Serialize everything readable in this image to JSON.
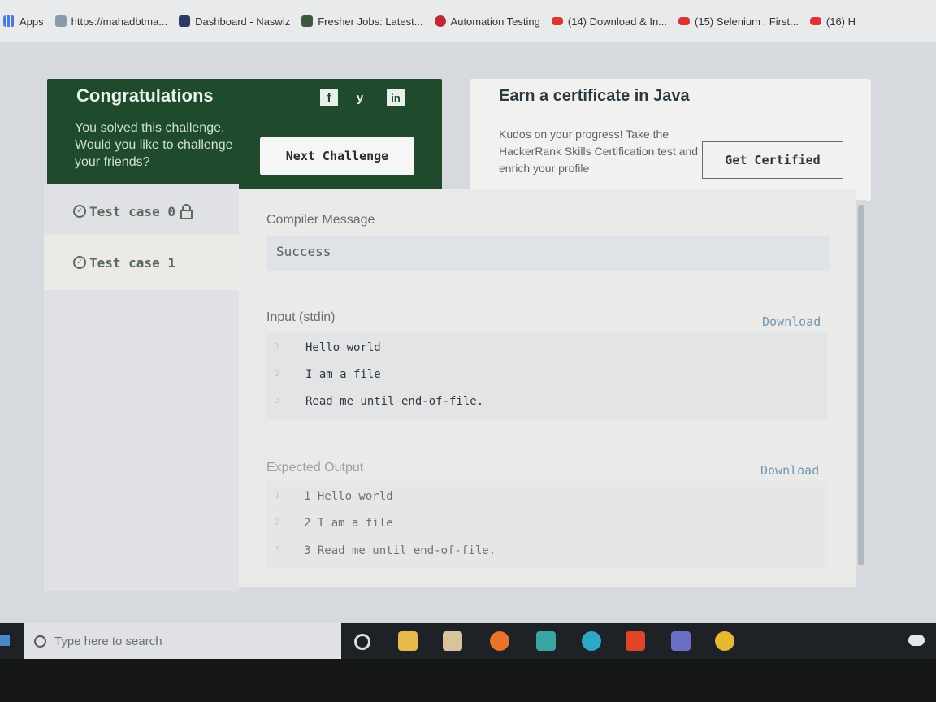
{
  "bookmarks": [
    {
      "label": "Apps",
      "icon": "apps-grid-icon",
      "color": "#4a7bd6"
    },
    {
      "label": "https://mahadbtma...",
      "icon": "page-icon",
      "color": "#8a9aa8"
    },
    {
      "label": "Dashboard - Naswiz",
      "icon": "naswiz-icon",
      "color": "#2b3a67"
    },
    {
      "label": "Fresher Jobs: Latest...",
      "icon": "fresher-jobs-icon",
      "color": "#3a5a3a"
    },
    {
      "label": "Automation Testing",
      "icon": "automation-icon",
      "color": "#c0283a"
    },
    {
      "label": "(14) Download & In...",
      "icon": "youtube-icon",
      "color": "#d33333"
    },
    {
      "label": "(15) Selenium : First...",
      "icon": "youtube-icon",
      "color": "#d33333"
    },
    {
      "label": "(16) H",
      "icon": "youtube-icon",
      "color": "#d33333"
    }
  ],
  "congrats": {
    "title": "Congratulations",
    "text": "You solved this challenge. Would you like to challenge your friends?",
    "next_button": "Next Challenge",
    "social": [
      "f",
      "y",
      "in"
    ]
  },
  "certificate": {
    "title": "Earn a certificate in Java",
    "text": "Kudos on your progress! Take the HackerRank Skills Certification test and enrich your profile",
    "button": "Get Certified"
  },
  "test_cases": [
    {
      "label": "Test case 0",
      "locked": true,
      "active": false
    },
    {
      "label": "Test case 1",
      "locked": false,
      "active": true
    }
  ],
  "compiler": {
    "label": "Compiler Message",
    "message": "Success"
  },
  "input": {
    "label": "Input (stdin)",
    "download": "Download",
    "lines": [
      {
        "num": "1",
        "text": "Hello world"
      },
      {
        "num": "2",
        "text": "I am a file"
      },
      {
        "num": "3",
        "text": "Read me until end-of-file."
      }
    ]
  },
  "expected": {
    "label": "Expected Output",
    "download": "Download",
    "lines": [
      {
        "num": "1",
        "text": "1 Hello world"
      },
      {
        "num": "2",
        "text": "2 I am a file"
      },
      {
        "num": "3",
        "text": "3 Read me until end-of-file."
      }
    ]
  },
  "taskbar": {
    "search_placeholder": "Type here to search",
    "apps": [
      {
        "name": "cortana-icon",
        "color": "#dddddd"
      },
      {
        "name": "file-explorer-icon",
        "color": "#e8b94a"
      },
      {
        "name": "store-icon",
        "color": "#d8c39a"
      },
      {
        "name": "firefox-icon",
        "color": "#e8742a"
      },
      {
        "name": "mail-icon",
        "color": "#3aa5a0"
      },
      {
        "name": "edge-icon",
        "color": "#2fa8c8"
      },
      {
        "name": "office-icon",
        "color": "#e0452a"
      },
      {
        "name": "teams-icon",
        "color": "#6a6fc8"
      },
      {
        "name": "chrome-icon",
        "color": "#e8b830"
      }
    ]
  }
}
